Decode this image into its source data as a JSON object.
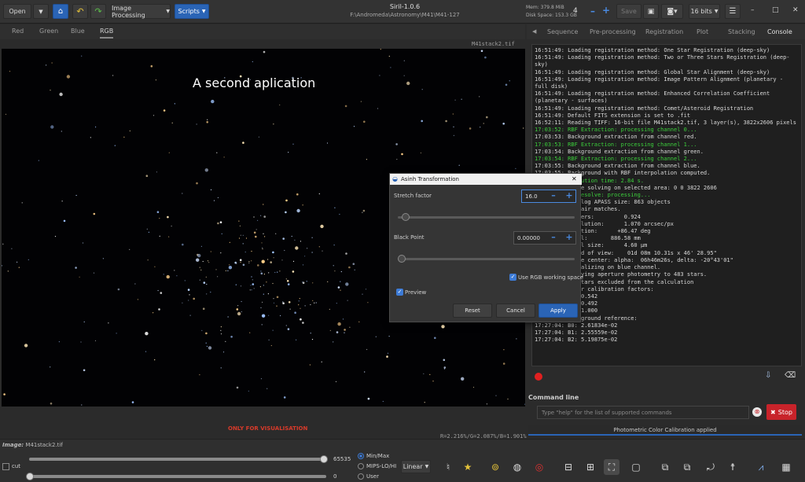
{
  "header": {
    "open_label": "Open",
    "image_processing_label": "Image Processing",
    "scripts_label": "Scripts",
    "app_title": "Siril-1.0.6",
    "app_path": "F:\\Andromeda\\Astronomy\\M41\\M41-127",
    "mem_text": "Mem: 379.8 MiB",
    "disk_text": "Disk Space: 153.3 GB",
    "threads_value": "4",
    "save_label": "Save",
    "bit_depth_label": "16 bits",
    "minimize_icon": "–",
    "maximize_icon": "□",
    "close_icon": "✕"
  },
  "channel_tabs": [
    "Red",
    "Green",
    "Blue",
    "RGB"
  ],
  "active_channel": "RGB",
  "image": {
    "filename": "M41stack2.tif",
    "caption": "A second aplication",
    "visualisation_note": "ONLY FOR VISUALISATION",
    "rgb_readout": "R=2.216%/G=2.087%/B=1.901%"
  },
  "right_tabs": [
    "Sequence",
    "Pre-processing",
    "Registration",
    "Plot",
    "Stacking",
    "Console"
  ],
  "active_right_tab": "Console",
  "console_lines": [
    {
      "t": "16:51:49: Loading registration method: One Star Registration (deep-sky)",
      "c": "w"
    },
    {
      "t": "16:51:49: Loading registration method: Two or Three Stars Registration (deep-",
      "c": "w"
    },
    {
      "t": "sky)",
      "c": "w"
    },
    {
      "t": "16:51:49: Loading registration method: Global Star Alignment (deep-sky)",
      "c": "w"
    },
    {
      "t": "16:51:49: Loading registration method: Image Pattern Alignment (planetary -",
      "c": "w"
    },
    {
      "t": "full disk)",
      "c": "w"
    },
    {
      "t": "16:51:49: Loading registration method: Enhanced Correlation Coefficient",
      "c": "w"
    },
    {
      "t": "(planetary - surfaces)",
      "c": "w"
    },
    {
      "t": "16:51:49: Loading registration method: Comet/Asteroid Registration",
      "c": "w"
    },
    {
      "t": "16:51:49: Default FITS extension is set to .fit",
      "c": "w"
    },
    {
      "t": "16:52:11: Reading TIFF: 16-bit file M41stack2.tif, 3 layer(s), 3822x2606 pixels",
      "c": "w"
    },
    {
      "t": "17:03:52: RBF Extraction: processing channel 0...",
      "c": "g"
    },
    {
      "t": "17:03:53: Background extraction from channel red.",
      "c": "w"
    },
    {
      "t": "17:03:53: RBF Extraction: processing channel 1...",
      "c": "g"
    },
    {
      "t": "17:03:54: Background extraction from channel green.",
      "c": "w"
    },
    {
      "t": "17:03:54: RBF Extraction: processing channel 2...",
      "c": "g"
    },
    {
      "t": "17:03:55: Background extraction from channel blue.",
      "c": "w"
    },
    {
      "t": "17:03:55: Background with RBF interpolation computed.",
      "c": "w"
    },
    {
      "t": "17:03:55: Execution time: 2.84 s.",
      "c": "g"
    },
    {
      "t": "17:26:57: Plate solving on selected area: 0 0 3822 2606",
      "c": "w"
    },
    {
      "t": "17:26:57: Platesolve: processing...",
      "c": "g"
    },
    {
      "t": "17:27:02: Catalog APASS size: 863 objects",
      "c": "w"
    },
    {
      "t": "17:27:02: 47 pair matches.",
      "c": "w"
    },
    {
      "t": "17:27:02: Inliers:         0.924",
      "c": "w"
    },
    {
      "t": "17:27:02: Resolution:      1.070 arcsec/px",
      "c": "w"
    },
    {
      "t": "17:27:02: Rotation:      +86.47 deg",
      "c": "w"
    },
    {
      "t": "17:27:02: Focal:       886.58 mm",
      "c": "w"
    },
    {
      "t": "17:27:02: Pixel size:      4.60 µm",
      "c": "w"
    },
    {
      "t": "17:27:02: Field of view:    01d 08m 10.31s x 46' 28.95\"",
      "c": "w"
    },
    {
      "t": "17:27:02: Image center: alpha:  06h46m26s, delta: -20°43'01\"",
      "c": "w"
    },
    {
      "t": "17:27:03: Normalizing on blue channel.",
      "c": "w"
    },
    {
      "t": "17:27:03: Applying aperture photometry to 483 stars.",
      "c": "w"
    },
    {
      "t": "17:27:04: 20 stars excluded from the calculation",
      "c": "w"
    },
    {
      "t": "17:27:04: Color calibration factors:",
      "c": "w"
    },
    {
      "t": "17:27:04: K0: 0.542",
      "c": "w"
    },
    {
      "t": "17:27:04: K1: 0.492",
      "c": "w"
    },
    {
      "t": "17:27:04: K2: 1.000",
      "c": "w"
    },
    {
      "t": "17:27:04: Background reference:",
      "c": "w"
    },
    {
      "t": "17:27:04: B0: 2.61834e-02",
      "c": "w"
    },
    {
      "t": "17:27:04: B1: 2.55559e-02",
      "c": "w"
    },
    {
      "t": "17:27:04: B2: 5.19875e-02",
      "c": "w"
    }
  ],
  "command_line": {
    "label": "Command line",
    "placeholder": "Type \"help\" for the list of supported commands",
    "stop_label": "Stop",
    "status": "Photometric Color Calibration applied"
  },
  "bottom": {
    "image_label": "Image:",
    "image_name": "M41stack2.tif",
    "cut_label": "cut",
    "max_value": "65535",
    "min_value": "0",
    "scale_options": [
      "Min/Max",
      "MIPS-LO/HI",
      "User"
    ],
    "selected_scale": "Min/Max",
    "stretch_label": "Linear"
  },
  "dialog": {
    "title": "Asinh Transformation",
    "stretch_factor_label": "Stretch factor",
    "stretch_factor_value": "16.0",
    "stretch_factor_level": 0.02,
    "black_point_label": "Black Point",
    "black_point_value": "0.00000",
    "black_point_level": 0.0,
    "rgb_space_label": "Use RGB working space",
    "rgb_space_checked": true,
    "preview_label": "Preview",
    "preview_checked": true,
    "reset_label": "Reset",
    "cancel_label": "Cancel",
    "apply_label": "Apply"
  }
}
